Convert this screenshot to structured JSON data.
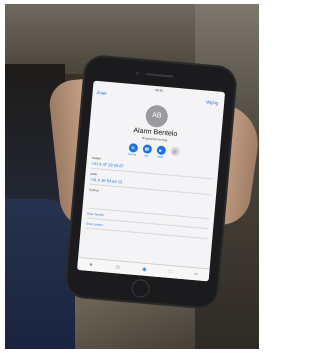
{
  "photo": {
    "description_colors": {
      "background": "#4a453b",
      "skin": "#c9a489",
      "phone_body": "#1b1b1d",
      "accent": "#1a73e8"
    }
  },
  "phone_screen": {
    "status_time": "09:45",
    "back_label": "Zoek",
    "edit_label": "Wijzig",
    "avatar_initials": "AB",
    "contact_name": "Alarm Bentelo",
    "contact_subtitle": "Brigadelid/verslag",
    "actions": [
      {
        "icon": "message-icon",
        "label": "bericht"
      },
      {
        "icon": "phone-icon",
        "label": "bel"
      },
      {
        "icon": "video-icon",
        "label": "video"
      },
      {
        "icon": "mail-icon",
        "label": ""
      }
    ],
    "fields": [
      {
        "label": "mobiel",
        "value": "+31 6 47 29 35 87"
      },
      {
        "label": "werk",
        "value": "+31 6 36 54 63 13"
      }
    ],
    "notes_label": "Notities",
    "link_rows": [
      "Stuur bericht",
      "Deel contact"
    ],
    "tabs": [
      {
        "icon": "star-icon",
        "active": false
      },
      {
        "icon": "clock-icon",
        "active": false
      },
      {
        "icon": "contacts-icon",
        "active": true
      },
      {
        "icon": "keypad-icon",
        "active": false
      },
      {
        "icon": "voicemail-icon",
        "active": false
      }
    ]
  }
}
